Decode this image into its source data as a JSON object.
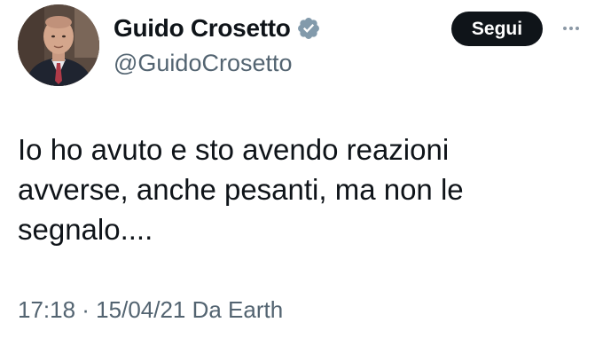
{
  "author": {
    "display_name": "Guido Crosetto",
    "handle": "@GuidoCrosetto",
    "verified_icon": "verified-badge-icon",
    "verified_color": "#829aab"
  },
  "actions": {
    "follow_label": "Segui",
    "more_icon": "more-options-icon"
  },
  "tweet": {
    "lines": [
      "Io ho avuto e sto avendo reazioni",
      "avverse, anche pesanti, ma non le",
      "segnalo...."
    ]
  },
  "meta": {
    "timestamp": "17:18 · 15/04/21 Da Earth"
  },
  "colors": {
    "text": "#0f1419",
    "secondary": "#536471",
    "button_bg": "#0f1419",
    "button_text": "#ffffff"
  }
}
